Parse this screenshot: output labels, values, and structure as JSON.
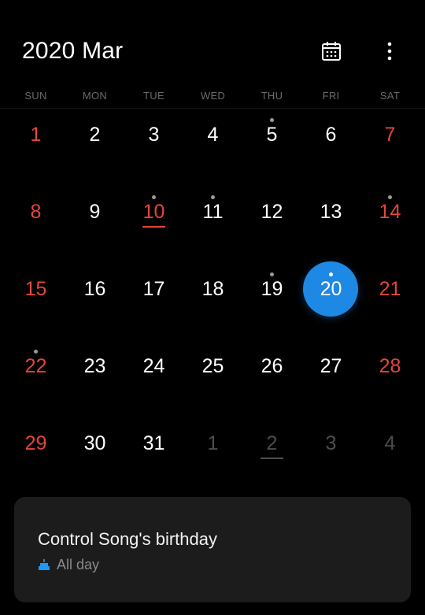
{
  "header": {
    "title": "2020 Mar",
    "calendar_icon": "calendar-grid-icon",
    "more_icon": "more-vertical-icon"
  },
  "weekdays": [
    "SUN",
    "MON",
    "TUE",
    "WED",
    "THU",
    "FRI",
    "SAT"
  ],
  "days": [
    {
      "label": "1",
      "weekend": true,
      "other": false,
      "dot": false
    },
    {
      "label": "2",
      "weekend": false,
      "other": false,
      "dot": false
    },
    {
      "label": "3",
      "weekend": false,
      "other": false,
      "dot": false
    },
    {
      "label": "4",
      "weekend": false,
      "other": false,
      "dot": false
    },
    {
      "label": "5",
      "weekend": false,
      "other": false,
      "dot": true
    },
    {
      "label": "6",
      "weekend": false,
      "other": false,
      "dot": false
    },
    {
      "label": "7",
      "weekend": true,
      "other": false,
      "dot": false
    },
    {
      "label": "8",
      "weekend": true,
      "other": false,
      "dot": false
    },
    {
      "label": "9",
      "weekend": false,
      "other": false,
      "dot": false
    },
    {
      "label": "10",
      "weekend": true,
      "other": false,
      "dot": true,
      "underline": true
    },
    {
      "label": "11",
      "weekend": false,
      "other": false,
      "dot": true
    },
    {
      "label": "12",
      "weekend": false,
      "other": false,
      "dot": false
    },
    {
      "label": "13",
      "weekend": false,
      "other": false,
      "dot": false
    },
    {
      "label": "14",
      "weekend": true,
      "other": false,
      "dot": true
    },
    {
      "label": "15",
      "weekend": true,
      "other": false,
      "dot": false
    },
    {
      "label": "16",
      "weekend": false,
      "other": false,
      "dot": false
    },
    {
      "label": "17",
      "weekend": false,
      "other": false,
      "dot": false
    },
    {
      "label": "18",
      "weekend": false,
      "other": false,
      "dot": false
    },
    {
      "label": "19",
      "weekend": false,
      "other": false,
      "dot": true
    },
    {
      "label": "20",
      "weekend": false,
      "other": false,
      "dot": true,
      "selected": true
    },
    {
      "label": "21",
      "weekend": true,
      "other": false,
      "dot": false
    },
    {
      "label": "22",
      "weekend": true,
      "other": false,
      "dot": true
    },
    {
      "label": "23",
      "weekend": false,
      "other": false,
      "dot": false
    },
    {
      "label": "24",
      "weekend": false,
      "other": false,
      "dot": false
    },
    {
      "label": "25",
      "weekend": false,
      "other": false,
      "dot": false
    },
    {
      "label": "26",
      "weekend": false,
      "other": false,
      "dot": false
    },
    {
      "label": "27",
      "weekend": false,
      "other": false,
      "dot": false
    },
    {
      "label": "28",
      "weekend": true,
      "other": false,
      "dot": false
    },
    {
      "label": "29",
      "weekend": true,
      "other": false,
      "dot": false
    },
    {
      "label": "30",
      "weekend": false,
      "other": false,
      "dot": false
    },
    {
      "label": "31",
      "weekend": false,
      "other": false,
      "dot": false
    },
    {
      "label": "1",
      "weekend": false,
      "other": true,
      "dot": false
    },
    {
      "label": "2",
      "weekend": false,
      "other": true,
      "dot": false,
      "underline": true
    },
    {
      "label": "3",
      "weekend": false,
      "other": true,
      "dot": false
    },
    {
      "label": "4",
      "weekend": false,
      "other": true,
      "dot": false
    }
  ],
  "event": {
    "title": "Control Song's birthday",
    "time": "All day",
    "icon": "cake-icon"
  },
  "colors": {
    "background": "#000000",
    "weekend": "#e5453a",
    "selected": "#1e88e5",
    "muted": "#4e4e4e",
    "card": "#1c1c1c"
  }
}
